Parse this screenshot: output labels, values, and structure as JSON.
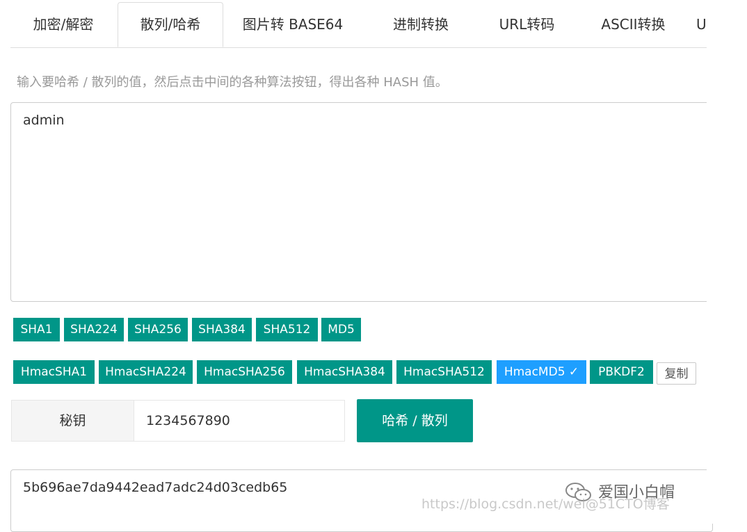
{
  "tabs": [
    {
      "label": "加密/解密"
    },
    {
      "label": "散列/哈希"
    },
    {
      "label": "图片转 BASE64"
    },
    {
      "label": "进制转换"
    },
    {
      "label": "URL转码"
    },
    {
      "label": "ASCII转换"
    },
    {
      "label": "U"
    }
  ],
  "active_tab": "散列/哈希",
  "hint": "输入要哈希 / 散列的值，然后点击中间的各种算法按钮，得出各种 HASH 值。",
  "input": {
    "value": "admin"
  },
  "hash_buttons": [
    {
      "label": "SHA1"
    },
    {
      "label": "SHA224"
    },
    {
      "label": "SHA256"
    },
    {
      "label": "SHA384"
    },
    {
      "label": "SHA512"
    },
    {
      "label": "MD5"
    }
  ],
  "hmac_buttons": [
    {
      "label": "HmacSHA1"
    },
    {
      "label": "HmacSHA224"
    },
    {
      "label": "HmacSHA256"
    },
    {
      "label": "HmacSHA384"
    },
    {
      "label": "HmacSHA512"
    },
    {
      "label": "HmacMD5 ✓"
    },
    {
      "label": "PBKDF2"
    }
  ],
  "selected_algorithm": "HmacMD5",
  "copy_label": "复制",
  "key": {
    "label": "秘钥",
    "value": "1234567890"
  },
  "hash_button_label": "哈希 / 散列",
  "output": {
    "value": "5b696ae7da9442ead7adc24d03cedb65"
  },
  "watermark": {
    "name": "爱国小白帽",
    "url": "https://blog.csdn.net/wei@51CTO博客"
  },
  "colors": {
    "primary": "#009688",
    "selected": "#1e9fff",
    "hint": "#999999"
  }
}
